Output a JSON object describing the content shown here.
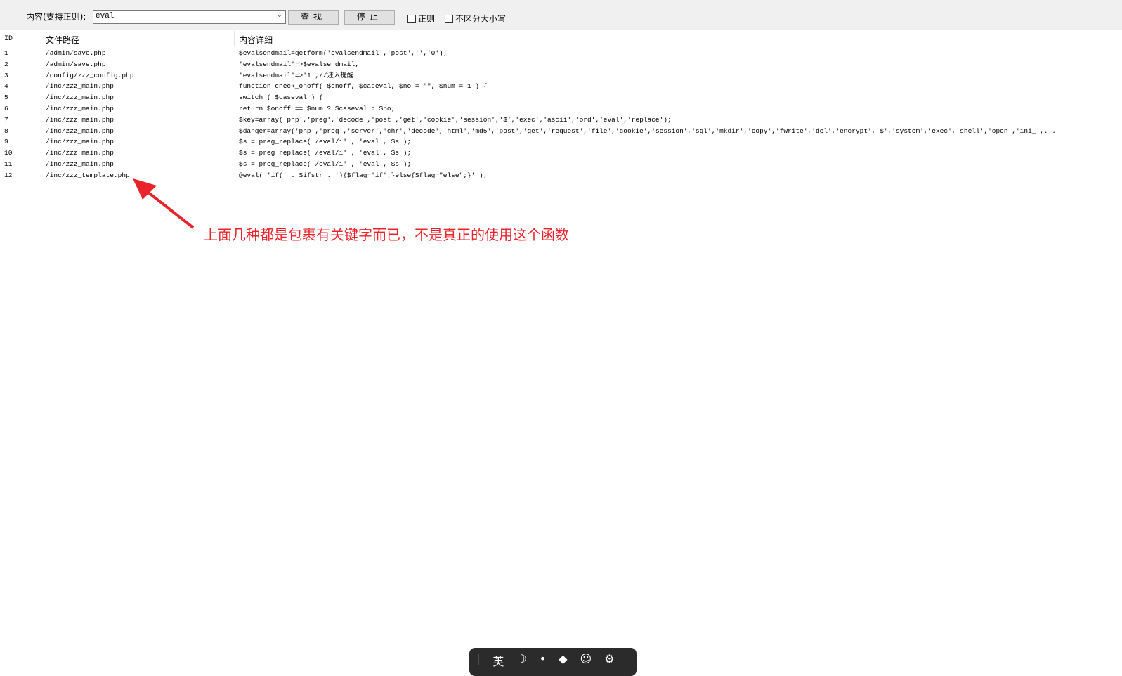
{
  "toolbar": {
    "content_label": "内容(支持正则):",
    "search_value": "eval",
    "find_button": "查找",
    "stop_button": "停止",
    "regex_label": "正则",
    "case_label": "不区分大小写"
  },
  "table": {
    "headers": [
      "ID",
      "文件路径",
      "内容详细"
    ],
    "rows": [
      [
        "1",
        "/admin/save.php",
        "$evalsendmail=getform('evalsendmail','post','','0');"
      ],
      [
        "2",
        "/admin/save.php",
        "'evalsendmail'=>$evalsendmail,"
      ],
      [
        "3",
        "/config/zzz_config.php",
        "'evalsendmail'=>'1',//注入提醒"
      ],
      [
        "4",
        "/inc/zzz_main.php",
        "function check_onoff( $onoff, $caseval, $no = \"\", $num = 1 ) {"
      ],
      [
        "5",
        "/inc/zzz_main.php",
        "switch ( $caseval ) {"
      ],
      [
        "6",
        "/inc/zzz_main.php",
        "return $onoff == $num ? $caseval : $no;"
      ],
      [
        "7",
        "/inc/zzz_main.php",
        "$key=array('php','preg','decode','post','get','cookie','session','$','exec','ascii','ord','eval','replace');"
      ],
      [
        "8",
        "/inc/zzz_main.php",
        "$danger=array('php','preg','server','chr','decode','html','md5','post','get','request','file','cookie','session','sql','mkdir','copy','fwrite','del','encrypt','$','system','exec','shell','open','ini_',..."
      ],
      [
        "9",
        "/inc/zzz_main.php",
        "$s = preg_replace('/eval/i' , 'eval', $s );"
      ],
      [
        "10",
        "/inc/zzz_main.php",
        "$s = preg_replace('/eval/i' , 'eval', $s );"
      ],
      [
        "11",
        "/inc/zzz_main.php",
        "$s = preg_replace('/eval/i' , 'eval', $s );"
      ],
      [
        "12",
        "/inc/zzz_template.php",
        "@eval( 'if(' . $ifstr . '){$flag=\"if\";}else{$flag=\"else\";}' );"
      ]
    ]
  },
  "annotation": "上面几种都是包裹有关键字而已，不是真正的使用这个函数",
  "ime": {
    "lang": "英"
  }
}
